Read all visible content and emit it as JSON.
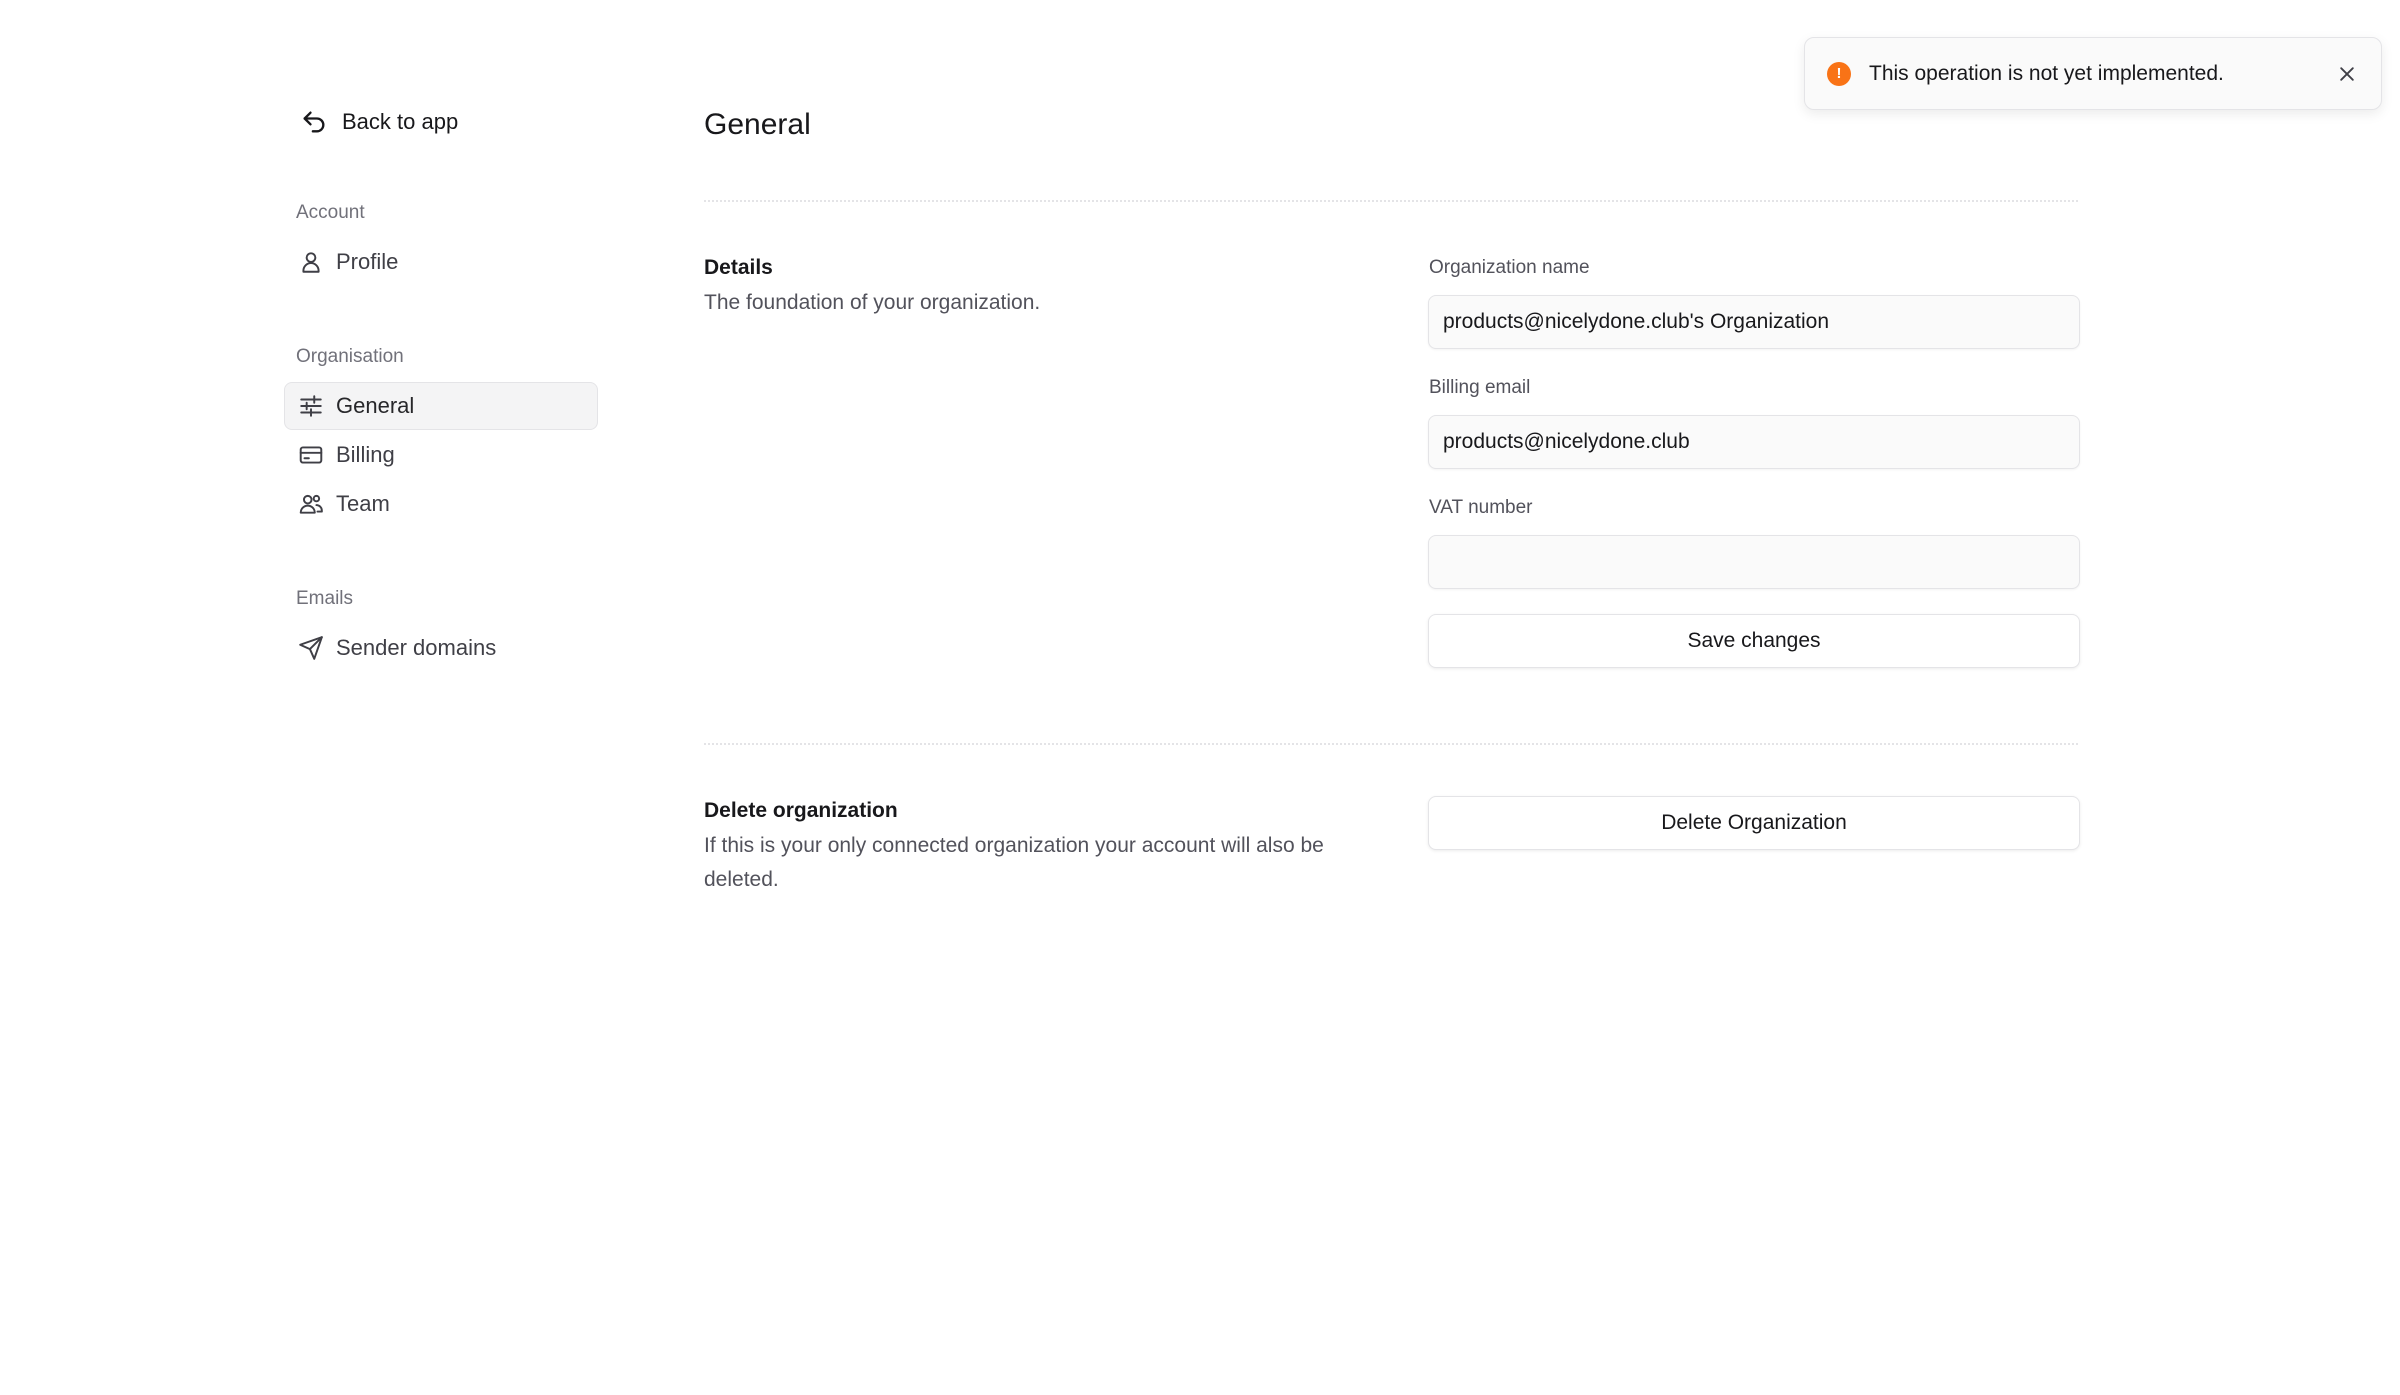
{
  "sidebar": {
    "back_label": "Back to app",
    "sections": [
      {
        "heading": "Account",
        "items": [
          {
            "label": "Profile",
            "icon": "user-icon"
          }
        ]
      },
      {
        "heading": "Organisation",
        "items": [
          {
            "label": "General",
            "icon": "sliders-icon",
            "active": true
          },
          {
            "label": "Billing",
            "icon": "credit-card-icon"
          },
          {
            "label": "Team",
            "icon": "users-icon"
          }
        ]
      },
      {
        "heading": "Emails",
        "items": [
          {
            "label": "Sender domains",
            "icon": "send-icon"
          }
        ]
      }
    ]
  },
  "main": {
    "title": "General",
    "details": {
      "title": "Details",
      "description": "The foundation of your organization.",
      "fields": [
        {
          "label": "Organization name",
          "value": "products@nicelydone.club's Organization"
        },
        {
          "label": "Billing email",
          "value": "products@nicelydone.club"
        },
        {
          "label": "VAT number",
          "value": ""
        }
      ],
      "save_label": "Save changes"
    },
    "delete": {
      "title": "Delete organization",
      "description": "If this is your only connected organization your account will also be deleted.",
      "button_label": "Delete Organization"
    }
  },
  "toast": {
    "message": "This operation is not yet implemented.",
    "icon": "alert-circle-icon",
    "accent": "#f97316"
  }
}
